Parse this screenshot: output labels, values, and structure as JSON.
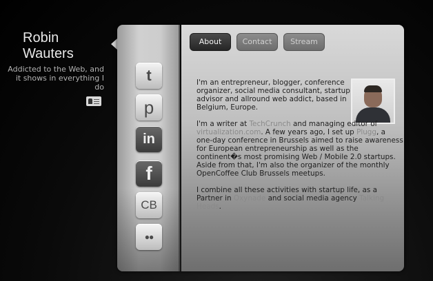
{
  "profile": {
    "name_line1": "Robin",
    "name_line2": "Wauters",
    "tagline": "Addicted to the Web, and it shows in everything I do",
    "vcard_icon": "vcard-icon"
  },
  "tabs": [
    {
      "label": "About",
      "active": true
    },
    {
      "label": "Contact",
      "active": false
    },
    {
      "label": "Stream",
      "active": false
    }
  ],
  "social": [
    {
      "name": "twitter",
      "glyph": "t",
      "icon": "twitter-icon"
    },
    {
      "name": "posterous",
      "glyph": "p",
      "icon": "posterous-icon"
    },
    {
      "name": "linkedin",
      "glyph": "in",
      "icon": "linkedin-icon"
    },
    {
      "name": "facebook",
      "glyph": "f",
      "icon": "facebook-icon"
    },
    {
      "name": "crunchbase",
      "glyph": "CB",
      "icon": "crunchbase-icon"
    },
    {
      "name": "flickr",
      "glyph": "●●",
      "icon": "flickr-icon"
    }
  ],
  "about": {
    "p1": "I'm an entrepreneur, blogger, conference organizer, social media consultant, startup advisor and allround web addict, based in Belgium, Europe.",
    "p2": {
      "t1": "I'm a writer at ",
      "link1": "TechCrunch",
      "t2": " and managing editor of ",
      "link2": "virtualization.com",
      "t3": ". A few years ago, I set up ",
      "link3": "Plugg",
      "t4": ", a one-day conference in Brussels aimed to raise awareness for European entrepreneurship as well as the continent�s most promising Web / Mobile 2.0 startups. Aside from that, I'm also the organizer of the monthly OpenCoffee Club Brussels meetups."
    },
    "p3": {
      "t1": "I combine all these activities with startup life, as a Partner in ",
      "link1": "Oxynade",
      "t2": " and social media agency ",
      "link2": "Talking Heads",
      "t3": "."
    }
  }
}
